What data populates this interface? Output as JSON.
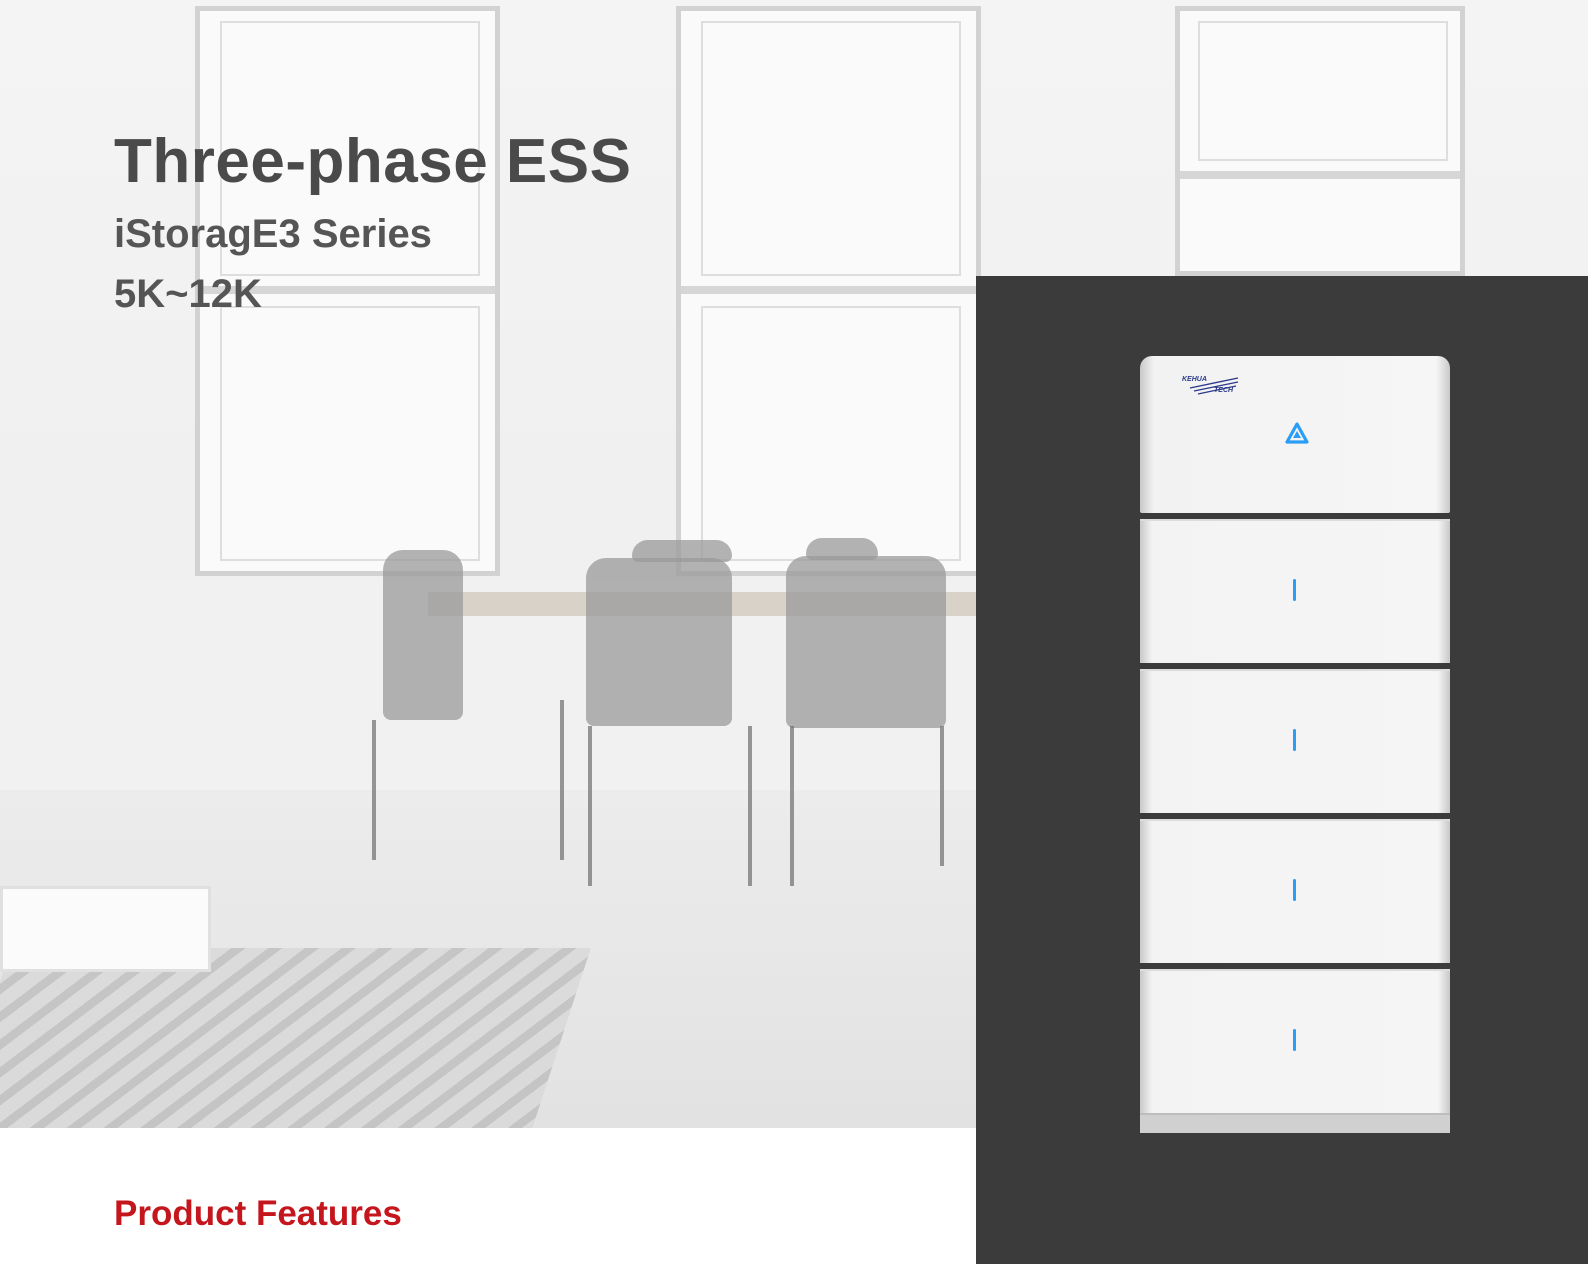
{
  "heading": {
    "title": "Three-phase ESS",
    "series": "iStoragE3 Series",
    "power_range": "5K~12K"
  },
  "section": {
    "label": "Product Features"
  },
  "product": {
    "brand_line1": "KEHUA",
    "brand_line2": "TECH",
    "battery_modules": 4
  },
  "colors": {
    "accent_red": "#c4161c",
    "led_blue": "#2a9df4",
    "panel_dark": "#3b3b3b"
  },
  "icons": [
    "kehua-logo-icon",
    "status-indicator-icon",
    "battery-led-icon"
  ]
}
